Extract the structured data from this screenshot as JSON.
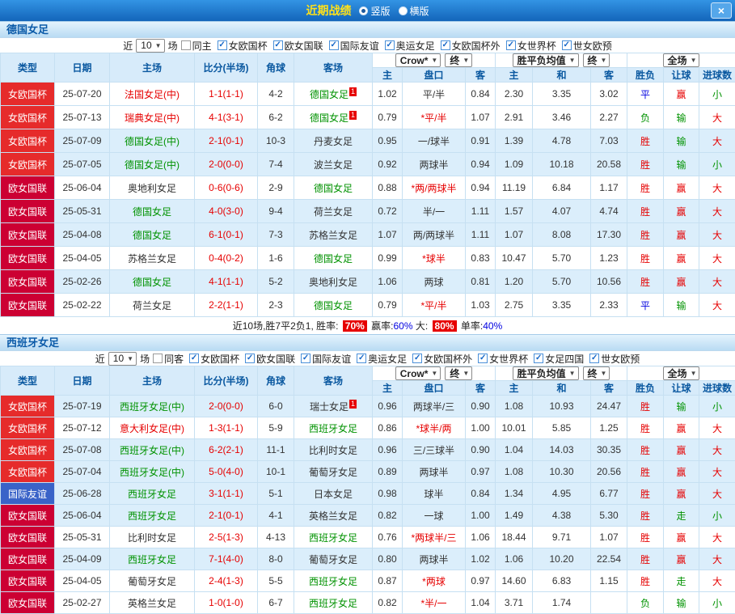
{
  "titlebar": {
    "title": "近期战绩",
    "radio_vertical": "竖版",
    "radio_horizontal": "横版",
    "selected": "竖版",
    "close_label": "×"
  },
  "colors": {
    "accent_blue": "#1365ba",
    "cup_red": "#e62b2b",
    "league_crimson": "#cc0033",
    "friendly_blue": "#3a63c8",
    "win_red": "#e60000",
    "lose_green": "#009200",
    "draw_blue": "#0000e0"
  },
  "shared": {
    "near_label": "近",
    "count": "10",
    "games_label": "场",
    "header_cols": [
      "类型",
      "日期",
      "主场",
      "比分(半场)",
      "角球",
      "客场"
    ],
    "dd_odds": "Crow*",
    "dd_final": "终",
    "dd_avg": "胜平负均值",
    "dd_full": "全场",
    "sub_cols": [
      "主",
      "盘口",
      "客",
      "主",
      "和",
      "客",
      "胜负",
      "让球",
      "进球数"
    ]
  },
  "sections": [
    {
      "team": "德国女足",
      "filters": [
        {
          "label": "同主",
          "checked": false
        },
        {
          "label": "女欧国杯",
          "checked": true
        },
        {
          "label": "欧女国联",
          "checked": true
        },
        {
          "label": "国际友谊",
          "checked": true
        },
        {
          "label": "奥运女足",
          "checked": true
        },
        {
          "label": "女欧国杯外",
          "checked": true
        },
        {
          "label": "女世界杯",
          "checked": true
        },
        {
          "label": "世女欧预",
          "checked": true
        }
      ],
      "rows": [
        {
          "type": "女欧国杯",
          "type_bg": "#e62b2b",
          "date": "25-07-20",
          "home": "法国女足(中)",
          "home_color": "red",
          "score": "1-1(1-1)",
          "corners": "4-2",
          "away": "德国女足",
          "away_color": "green",
          "away_badge": "1",
          "o1": "1.02",
          "hcp": "平/半",
          "hcp_red": false,
          "o2": "0.84",
          "a1": "2.30",
          "a2": "3.35",
          "a3": "3.02",
          "res": "平",
          "res_color": "blue",
          "hres": "赢",
          "hres_color": "red",
          "goals": "小",
          "goals_color": "green",
          "hl": false
        },
        {
          "type": "女欧国杯",
          "type_bg": "#e62b2b",
          "date": "25-07-13",
          "home": "瑞典女足(中)",
          "home_color": "red",
          "score": "4-1(3-1)",
          "corners": "6-2",
          "away": "德国女足",
          "away_color": "green",
          "away_badge": "1",
          "o1": "0.79",
          "hcp": "*平/半",
          "hcp_red": true,
          "o2": "1.07",
          "a1": "2.91",
          "a2": "3.46",
          "a3": "2.27",
          "res": "负",
          "res_color": "green",
          "hres": "输",
          "hres_color": "green",
          "goals": "大",
          "goals_color": "red",
          "hl": false
        },
        {
          "type": "女欧国杯",
          "type_bg": "#e62b2b",
          "date": "25-07-09",
          "home": "德国女足(中)",
          "home_color": "green",
          "score": "2-1(0-1)",
          "corners": "10-3",
          "away": "丹麦女足",
          "away_color": "black",
          "away_badge": "",
          "o1": "0.95",
          "hcp": "一/球半",
          "hcp_red": false,
          "o2": "0.91",
          "a1": "1.39",
          "a2": "4.78",
          "a3": "7.03",
          "res": "胜",
          "res_color": "red",
          "hres": "输",
          "hres_color": "green",
          "goals": "大",
          "goals_color": "red",
          "hl": true
        },
        {
          "type": "女欧国杯",
          "type_bg": "#e62b2b",
          "date": "25-07-05",
          "home": "德国女足(中)",
          "home_color": "green",
          "score": "2-0(0-0)",
          "corners": "7-4",
          "away": "波兰女足",
          "away_color": "black",
          "away_badge": "",
          "o1": "0.92",
          "hcp": "两球半",
          "hcp_red": false,
          "o2": "0.94",
          "a1": "1.09",
          "a2": "10.18",
          "a3": "20.58",
          "res": "胜",
          "res_color": "red",
          "hres": "输",
          "hres_color": "green",
          "goals": "小",
          "goals_color": "green",
          "hl": true
        },
        {
          "type": "欧女国联",
          "type_bg": "#cc0033",
          "date": "25-06-04",
          "home": "奥地利女足",
          "home_color": "black",
          "score": "0-6(0-6)",
          "corners": "2-9",
          "away": "德国女足",
          "away_color": "green",
          "away_badge": "",
          "o1": "0.88",
          "hcp": "*两/两球半",
          "hcp_red": true,
          "o2": "0.94",
          "a1": "11.19",
          "a2": "6.84",
          "a3": "1.17",
          "res": "胜",
          "res_color": "red",
          "hres": "赢",
          "hres_color": "red",
          "goals": "大",
          "goals_color": "red",
          "hl": false
        },
        {
          "type": "欧女国联",
          "type_bg": "#cc0033",
          "date": "25-05-31",
          "home": "德国女足",
          "home_color": "green",
          "score": "4-0(3-0)",
          "corners": "9-4",
          "away": "荷兰女足",
          "away_color": "black",
          "away_badge": "",
          "o1": "0.72",
          "hcp": "半/一",
          "hcp_red": false,
          "o2": "1.11",
          "a1": "1.57",
          "a2": "4.07",
          "a3": "4.74",
          "res": "胜",
          "res_color": "red",
          "hres": "赢",
          "hres_color": "red",
          "goals": "大",
          "goals_color": "red",
          "hl": true
        },
        {
          "type": "欧女国联",
          "type_bg": "#cc0033",
          "date": "25-04-08",
          "home": "德国女足",
          "home_color": "green",
          "score": "6-1(0-1)",
          "corners": "7-3",
          "away": "苏格兰女足",
          "away_color": "black",
          "away_badge": "",
          "o1": "1.07",
          "hcp": "两/两球半",
          "hcp_red": false,
          "o2": "1.11",
          "a1": "1.07",
          "a2": "8.08",
          "a3": "17.30",
          "res": "胜",
          "res_color": "red",
          "hres": "赢",
          "hres_color": "red",
          "goals": "大",
          "goals_color": "red",
          "hl": true
        },
        {
          "type": "欧女国联",
          "type_bg": "#cc0033",
          "date": "25-04-05",
          "home": "苏格兰女足",
          "home_color": "black",
          "score": "0-4(0-2)",
          "corners": "1-6",
          "away": "德国女足",
          "away_color": "green",
          "away_badge": "",
          "o1": "0.99",
          "hcp": "*球半",
          "hcp_red": true,
          "o2": "0.83",
          "a1": "10.47",
          "a2": "5.70",
          "a3": "1.23",
          "res": "胜",
          "res_color": "red",
          "hres": "赢",
          "hres_color": "red",
          "goals": "大",
          "goals_color": "red",
          "hl": false
        },
        {
          "type": "欧女国联",
          "type_bg": "#cc0033",
          "date": "25-02-26",
          "home": "德国女足",
          "home_color": "green",
          "score": "4-1(1-1)",
          "corners": "5-2",
          "away": "奥地利女足",
          "away_color": "black",
          "away_badge": "",
          "o1": "1.06",
          "hcp": "两球",
          "hcp_red": false,
          "o2": "0.81",
          "a1": "1.20",
          "a2": "5.70",
          "a3": "10.56",
          "res": "胜",
          "res_color": "red",
          "hres": "赢",
          "hres_color": "red",
          "goals": "大",
          "goals_color": "red",
          "hl": true
        },
        {
          "type": "欧女国联",
          "type_bg": "#cc0033",
          "date": "25-02-22",
          "home": "荷兰女足",
          "home_color": "black",
          "score": "2-2(1-1)",
          "corners": "2-3",
          "away": "德国女足",
          "away_color": "green",
          "away_badge": "",
          "o1": "0.79",
          "hcp": "*平/半",
          "hcp_red": true,
          "o2": "1.03",
          "a1": "2.75",
          "a2": "3.35",
          "a3": "2.33",
          "res": "平",
          "res_color": "blue",
          "hres": "输",
          "hres_color": "green",
          "goals": "大",
          "goals_color": "red",
          "hl": false
        }
      ],
      "summary": {
        "parts": [
          {
            "text": "近10场,胜7平2负1, 胜率: ",
            "style": "plain"
          },
          {
            "text": "70%",
            "style": "badge"
          },
          {
            "text": " 赢率:",
            "style": "plain"
          },
          {
            "text": "60%",
            "style": "blue"
          },
          {
            "text": " 大: ",
            "style": "plain"
          },
          {
            "text": "80%",
            "style": "badge"
          },
          {
            "text": " 单率:",
            "style": "plain"
          },
          {
            "text": "40%",
            "style": "blue"
          }
        ]
      }
    },
    {
      "team": "西班牙女足",
      "filters": [
        {
          "label": "同客",
          "checked": false
        },
        {
          "label": "女欧国杯",
          "checked": true
        },
        {
          "label": "欧女国联",
          "checked": true
        },
        {
          "label": "国际友谊",
          "checked": true
        },
        {
          "label": "奥运女足",
          "checked": true
        },
        {
          "label": "女欧国杯外",
          "checked": true
        },
        {
          "label": "女世界杯",
          "checked": true
        },
        {
          "label": "女足四国",
          "checked": true
        },
        {
          "label": "世女欧预",
          "checked": true
        }
      ],
      "rows": [
        {
          "type": "女欧国杯",
          "type_bg": "#e62b2b",
          "date": "25-07-19",
          "home": "西班牙女足(中)",
          "home_color": "green",
          "score": "2-0(0-0)",
          "corners": "6-0",
          "away": "瑞士女足",
          "away_color": "black",
          "away_badge": "1",
          "o1": "0.96",
          "hcp": "两球半/三",
          "hcp_red": false,
          "o2": "0.90",
          "a1": "1.08",
          "a2": "10.93",
          "a3": "24.47",
          "res": "胜",
          "res_color": "red",
          "hres": "输",
          "hres_color": "green",
          "goals": "小",
          "goals_color": "green",
          "hl": true
        },
        {
          "type": "女欧国杯",
          "type_bg": "#e62b2b",
          "date": "25-07-12",
          "home": "意大利女足(中)",
          "home_color": "red",
          "score": "1-3(1-1)",
          "corners": "5-9",
          "away": "西班牙女足",
          "away_color": "green",
          "away_badge": "",
          "o1": "0.86",
          "hcp": "*球半/两",
          "hcp_red": true,
          "o2": "1.00",
          "a1": "10.01",
          "a2": "5.85",
          "a3": "1.25",
          "res": "胜",
          "res_color": "red",
          "hres": "赢",
          "hres_color": "red",
          "goals": "大",
          "goals_color": "red",
          "hl": false
        },
        {
          "type": "女欧国杯",
          "type_bg": "#e62b2b",
          "date": "25-07-08",
          "home": "西班牙女足(中)",
          "home_color": "green",
          "score": "6-2(2-1)",
          "corners": "11-1",
          "away": "比利时女足",
          "away_color": "black",
          "away_badge": "",
          "o1": "0.96",
          "hcp": "三/三球半",
          "hcp_red": false,
          "o2": "0.90",
          "a1": "1.04",
          "a2": "14.03",
          "a3": "30.35",
          "res": "胜",
          "res_color": "red",
          "hres": "赢",
          "hres_color": "red",
          "goals": "大",
          "goals_color": "red",
          "hl": true
        },
        {
          "type": "女欧国杯",
          "type_bg": "#e62b2b",
          "date": "25-07-04",
          "home": "西班牙女足(中)",
          "home_color": "green",
          "score": "5-0(4-0)",
          "corners": "10-1",
          "away": "葡萄牙女足",
          "away_color": "black",
          "away_badge": "",
          "o1": "0.89",
          "hcp": "两球半",
          "hcp_red": false,
          "o2": "0.97",
          "a1": "1.08",
          "a2": "10.30",
          "a3": "20.56",
          "res": "胜",
          "res_color": "red",
          "hres": "赢",
          "hres_color": "red",
          "goals": "大",
          "goals_color": "red",
          "hl": true
        },
        {
          "type": "国际友谊",
          "type_bg": "#3a63c8",
          "date": "25-06-28",
          "home": "西班牙女足",
          "home_color": "green",
          "score": "3-1(1-1)",
          "corners": "5-1",
          "away": "日本女足",
          "away_color": "black",
          "away_badge": "",
          "o1": "0.98",
          "hcp": "球半",
          "hcp_red": false,
          "o2": "0.84",
          "a1": "1.34",
          "a2": "4.95",
          "a3": "6.77",
          "res": "胜",
          "res_color": "red",
          "hres": "赢",
          "hres_color": "red",
          "goals": "大",
          "goals_color": "red",
          "hl": true
        },
        {
          "type": "欧女国联",
          "type_bg": "#cc0033",
          "date": "25-06-04",
          "home": "西班牙女足",
          "home_color": "green",
          "score": "2-1(0-1)",
          "corners": "4-1",
          "away": "英格兰女足",
          "away_color": "black",
          "away_badge": "",
          "o1": "0.82",
          "hcp": "一球",
          "hcp_red": false,
          "o2": "1.00",
          "a1": "1.49",
          "a2": "4.38",
          "a3": "5.30",
          "res": "胜",
          "res_color": "red",
          "hres": "走",
          "hres_color": "green",
          "goals": "小",
          "goals_color": "green",
          "hl": true
        },
        {
          "type": "欧女国联",
          "type_bg": "#cc0033",
          "date": "25-05-31",
          "home": "比利时女足",
          "home_color": "black",
          "score": "2-5(1-3)",
          "corners": "4-13",
          "away": "西班牙女足",
          "away_color": "green",
          "away_badge": "",
          "o1": "0.76",
          "hcp": "*两球半/三",
          "hcp_red": true,
          "o2": "1.06",
          "a1": "18.44",
          "a2": "9.71",
          "a3": "1.07",
          "res": "胜",
          "res_color": "red",
          "hres": "赢",
          "hres_color": "red",
          "goals": "大",
          "goals_color": "red",
          "hl": false
        },
        {
          "type": "欧女国联",
          "type_bg": "#cc0033",
          "date": "25-04-09",
          "home": "西班牙女足",
          "home_color": "green",
          "score": "7-1(4-0)",
          "corners": "8-0",
          "away": "葡萄牙女足",
          "away_color": "black",
          "away_badge": "",
          "o1": "0.80",
          "hcp": "两球半",
          "hcp_red": false,
          "o2": "1.02",
          "a1": "1.06",
          "a2": "10.20",
          "a3": "22.54",
          "res": "胜",
          "res_color": "red",
          "hres": "赢",
          "hres_color": "red",
          "goals": "大",
          "goals_color": "red",
          "hl": true
        },
        {
          "type": "欧女国联",
          "type_bg": "#cc0033",
          "date": "25-04-05",
          "home": "葡萄牙女足",
          "home_color": "black",
          "score": "2-4(1-3)",
          "corners": "5-5",
          "away": "西班牙女足",
          "away_color": "green",
          "away_badge": "",
          "o1": "0.87",
          "hcp": "*两球",
          "hcp_red": true,
          "o2": "0.97",
          "a1": "14.60",
          "a2": "6.83",
          "a3": "1.15",
          "res": "胜",
          "res_color": "red",
          "hres": "走",
          "hres_color": "green",
          "goals": "大",
          "goals_color": "red",
          "hl": false
        },
        {
          "type": "欧女国联",
          "type_bg": "#cc0033",
          "date": "25-02-27",
          "home": "英格兰女足",
          "home_color": "black",
          "score": "1-0(1-0)",
          "corners": "6-7",
          "away": "西班牙女足",
          "away_color": "green",
          "away_badge": "",
          "o1": "0.82",
          "hcp": "*半/一",
          "hcp_red": true,
          "o2": "1.04",
          "a1": "3.71",
          "a2": "1.74",
          "a3": "",
          "res": "负",
          "res_color": "green",
          "hres": "输",
          "hres_color": "green",
          "goals": "小",
          "goals_color": "green",
          "hl": false
        }
      ],
      "summary": null
    }
  ]
}
